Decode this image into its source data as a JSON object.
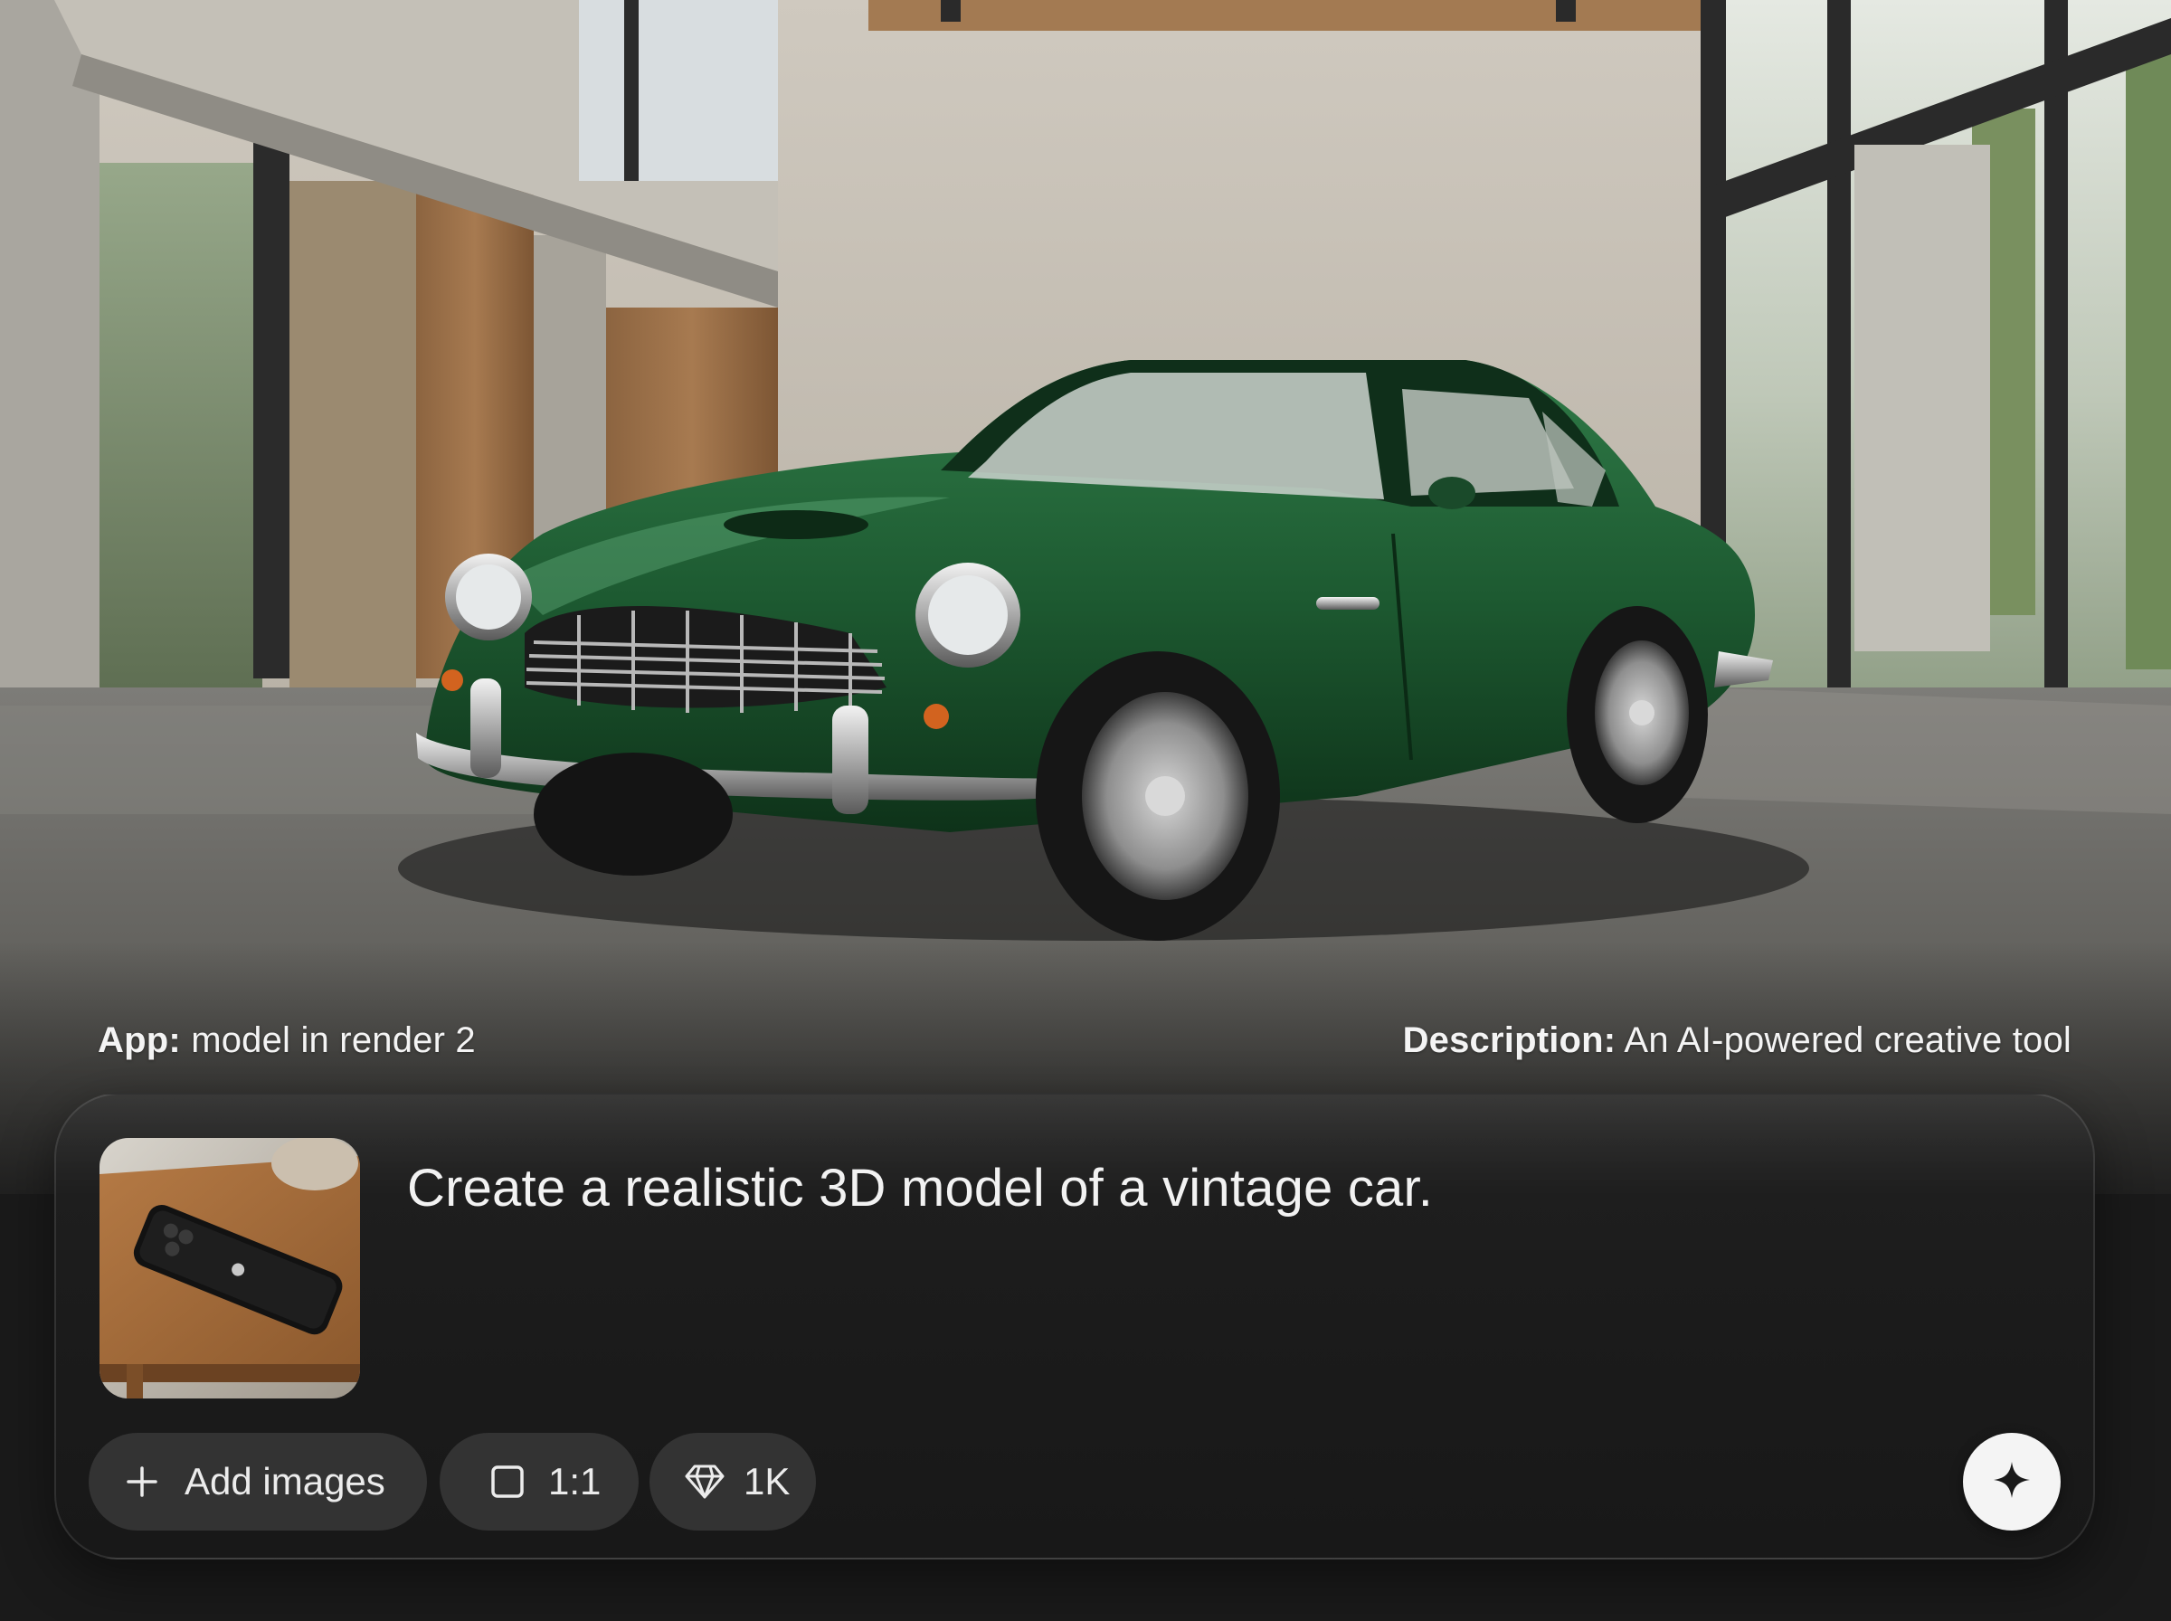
{
  "captions": {
    "app_label": "App:",
    "app_value": " model in render 2",
    "description_label": "Description:",
    "description_value": " An AI-powered creative tool"
  },
  "composer": {
    "prompt_text": "Create a realistic 3D model of a vintage car.",
    "attachment": "phone-on-table-thumbnail",
    "add_images_label": "Add images",
    "aspect_ratio": "1:1",
    "resolution": "1K",
    "icons": {
      "add": "plus-icon",
      "aspect_ratio": "square-icon",
      "resolution": "diamond-icon",
      "send": "sparkle-icon"
    }
  },
  "colors": {
    "car_green": "#1f5a32",
    "panel_bg": "#1e1e1e",
    "chip_bg": "#3c3c3c",
    "send_button": "#f4f4f4"
  }
}
